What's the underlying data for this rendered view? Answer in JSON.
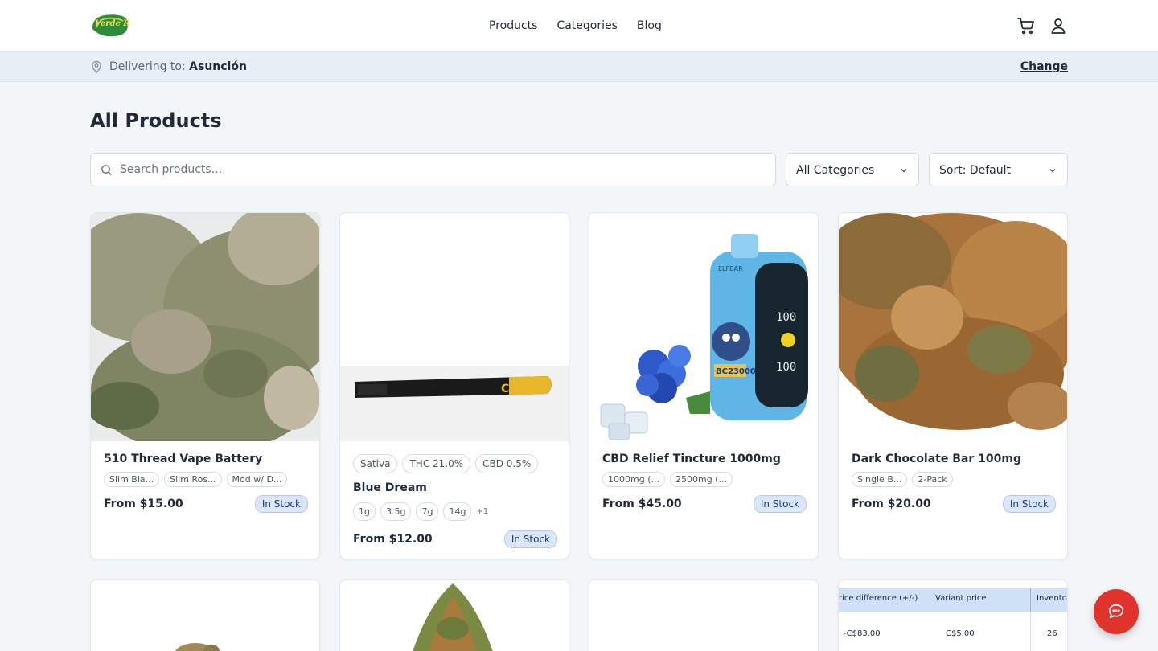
{
  "header": {
    "logo_text": "Verde Ruta",
    "nav": [
      "Products",
      "Categories",
      "Blog"
    ]
  },
  "delivery": {
    "prefix": "Delivering to:",
    "city": "Asunción",
    "change_label": "Change"
  },
  "page": {
    "title": "All Products"
  },
  "filters": {
    "search_placeholder": "Search products...",
    "category_value": "All Categories",
    "sort_value": "Sort: Default"
  },
  "products": [
    {
      "name": "510 Thread Vape Battery",
      "variants": [
        "Slim Bla...",
        "Slim Ros...",
        "Mod w/ D..."
      ],
      "price": "From $15.00",
      "stock": "In Stock",
      "image": "cannabis-bud-photo"
    },
    {
      "name": "Blue Dream",
      "tags": [
        "Sativa",
        "THC 21.0%",
        "CBD 0.5%"
      ],
      "variants": [
        "1g",
        "3.5g",
        "7g",
        "14g"
      ],
      "more": "+1",
      "price": "From $12.00",
      "stock": "In Stock",
      "image": "pre-rolled-cone-photo",
      "cone_label": "CONES"
    },
    {
      "name": "CBD Relief Tincture 1000mg",
      "variants": [
        "1000mg (...",
        "2500mg (..."
      ],
      "price": "From $45.00",
      "stock": "In Stock",
      "image": "disposable-vape-photo",
      "vape_brand": "ELFBAR",
      "vape_model": "BC23000",
      "vape_readout": "100"
    },
    {
      "name": "Dark Chocolate Bar 100mg",
      "variants": [
        "Single B...",
        "2-Pack"
      ],
      "price": "From $20.00",
      "stock": "In Stock",
      "image": "cannabis-bud-closeup-photo"
    }
  ],
  "second_row": {
    "table_headers": [
      "rice difference (+/-)",
      "Variant price",
      "Inventor"
    ],
    "table_row": [
      "-C$83.00",
      "C$5.00",
      "26"
    ]
  },
  "colors": {
    "accent_green": "#2e7d32",
    "chat_red": "#e0332b",
    "stock_badge_bg": "#dbe7f8"
  }
}
